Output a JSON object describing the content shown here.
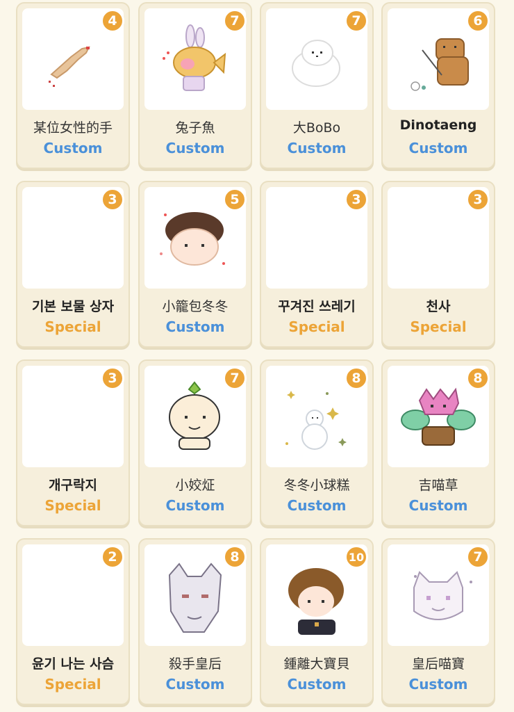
{
  "colors": {
    "custom": "#4a90d9",
    "special": "#eca437",
    "badge": "#eca437",
    "card": "#f6efdc"
  },
  "items": [
    {
      "name": "某位女性的手",
      "type": "Custom",
      "count": "4",
      "icon": "hand-icon"
    },
    {
      "name": "兔子魚",
      "type": "Custom",
      "count": "7",
      "icon": "bunny-fish-icon"
    },
    {
      "name": "大BoBo",
      "type": "Custom",
      "count": "7",
      "icon": "white-puppy-icon"
    },
    {
      "name": "Dinotaeng",
      "type": "Custom",
      "count": "6",
      "icon": "brown-bear-icon"
    },
    {
      "name": "기본 보물 상자",
      "type": "Special",
      "count": "3",
      "icon": "empty-image"
    },
    {
      "name": "小籠包冬冬",
      "type": "Custom",
      "count": "5",
      "icon": "dumpling-boy-icon"
    },
    {
      "name": "꾸겨진 쓰레기",
      "type": "Special",
      "count": "3",
      "icon": "empty-image"
    },
    {
      "name": "천사",
      "type": "Special",
      "count": "3",
      "icon": "empty-image"
    },
    {
      "name": "개구락지",
      "type": "Special",
      "count": "3",
      "icon": "empty-image"
    },
    {
      "name": "小姣炡",
      "type": "Custom",
      "count": "7",
      "icon": "sprout-bun-icon"
    },
    {
      "name": "冬冬小球糕",
      "type": "Custom",
      "count": "8",
      "icon": "snowman-sparkle-icon"
    },
    {
      "name": "吉喵草",
      "type": "Custom",
      "count": "8",
      "icon": "flower-cat-icon"
    },
    {
      "name": "윤기 나는 사슴",
      "type": "Special",
      "count": "2",
      "icon": "empty-image"
    },
    {
      "name": "殺手皇后",
      "type": "Custom",
      "count": "8",
      "icon": "white-fox-mask-icon"
    },
    {
      "name": "鍾離大寶貝",
      "type": "Custom",
      "count": "10",
      "icon": "brown-hair-boy-icon"
    },
    {
      "name": "皇后喵寶",
      "type": "Custom",
      "count": "7",
      "icon": "white-cat-icon"
    }
  ]
}
